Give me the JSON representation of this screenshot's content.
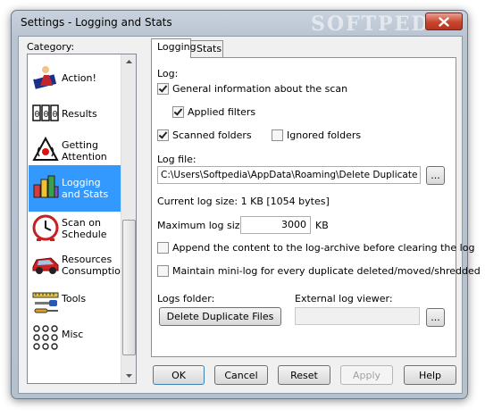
{
  "window": {
    "title": "Settings - Logging and Stats",
    "watermark": "SOFTPEDIA"
  },
  "sidebar": {
    "label": "Category:",
    "items": [
      {
        "label": "Action!",
        "icon": "action-icon"
      },
      {
        "label": "Results",
        "icon": "results-icon"
      },
      {
        "label": "Getting Attention",
        "icon": "attention-icon"
      },
      {
        "label": "Logging and Stats",
        "icon": "stats-icon",
        "selected": true
      },
      {
        "label": "Scan on Schedule",
        "icon": "clock-icon"
      },
      {
        "label": "Resources Consumption",
        "icon": "car-icon"
      },
      {
        "label": "Tools",
        "icon": "tools-icon"
      },
      {
        "label": "Misc",
        "icon": "misc-icon"
      }
    ]
  },
  "tabs": [
    {
      "label": "Logging",
      "active": true
    },
    {
      "label": "Stats"
    }
  ],
  "logging": {
    "log_label": "Log:",
    "general_info": {
      "label": "General information about the scan",
      "checked": true
    },
    "applied_filters": {
      "label": "Applied filters",
      "checked": true
    },
    "scanned_folders": {
      "label": "Scanned folders",
      "checked": true
    },
    "ignored_folders": {
      "label": "Ignored folders",
      "checked": false
    },
    "log_file_label": "Log file:",
    "log_file_value": "C:\\Users\\Softpedia\\AppData\\Roaming\\Delete Duplicate Files",
    "browse_label": "...",
    "current_size_text": "Current log size: 1 KB [1054 bytes]",
    "max_size_label": "Maximum log size:",
    "max_size_value": "3000",
    "max_size_unit": "KB",
    "append_archive": {
      "label": "Append the content to the log-archive before clearing the log",
      "checked": false
    },
    "mini_log": {
      "label": "Maintain mini-log for every duplicate deleted/moved/shredded",
      "checked": false
    },
    "logs_folder_label": "Logs folder:",
    "logs_folder_button": "Delete Duplicate Files",
    "external_viewer_label": "External log viewer:",
    "external_viewer_value": "",
    "viewer_browse_label": "..."
  },
  "buttons": {
    "ok": "OK",
    "cancel": "Cancel",
    "reset": "Reset",
    "apply": "Apply",
    "help": "Help"
  },
  "colors": {
    "selection": "#3399ff",
    "titlebar": "#c9d3df",
    "close": "#c9442c"
  }
}
